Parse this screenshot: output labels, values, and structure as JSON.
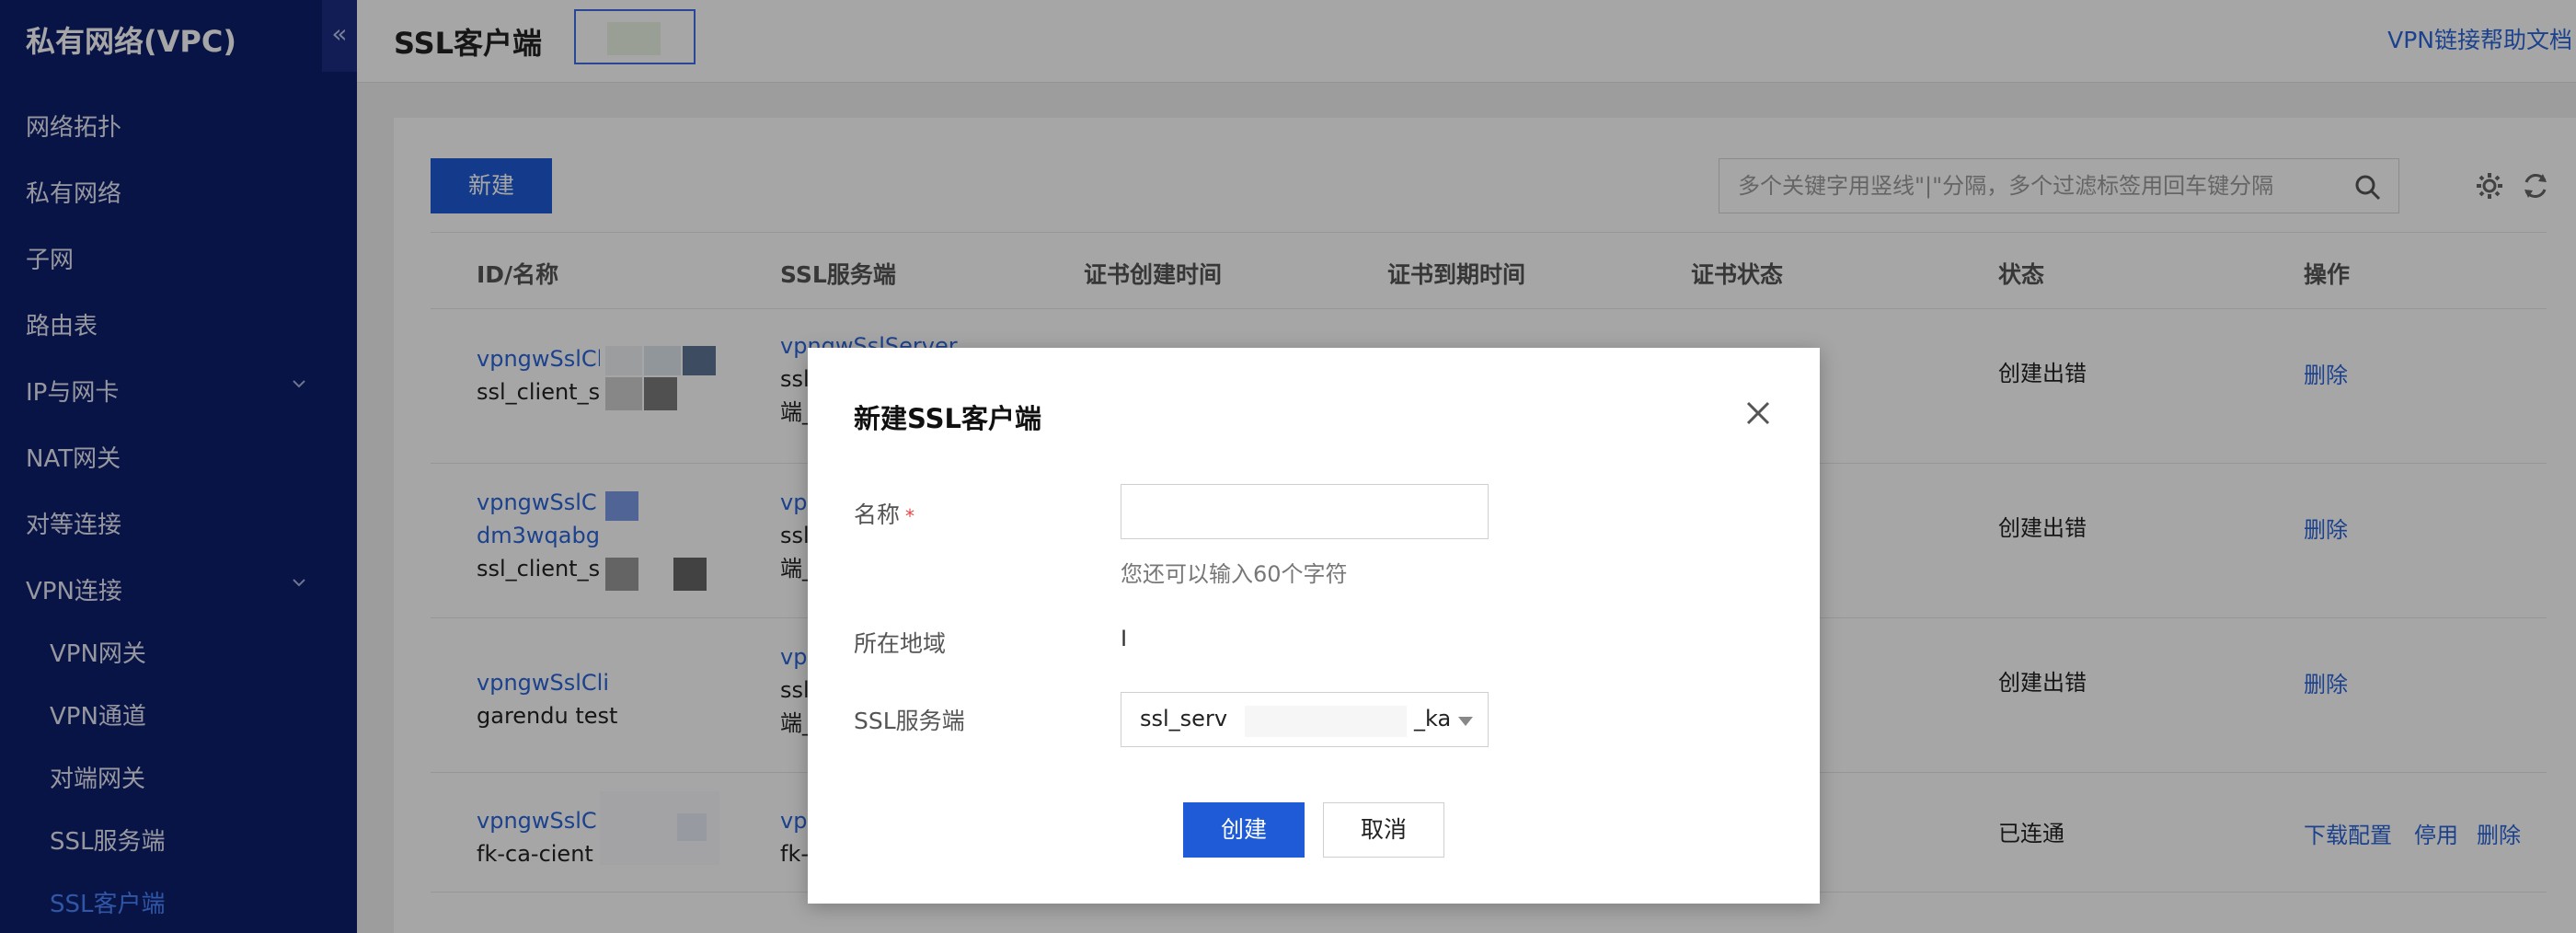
{
  "sidebar": {
    "title": "私有网络(VPC)",
    "collapse_icon": "«",
    "items": [
      {
        "label": "网络拓扑"
      },
      {
        "label": "私有网络"
      },
      {
        "label": "子网"
      },
      {
        "label": "路由表"
      },
      {
        "label": "IP与网卡"
      },
      {
        "label": "NAT网关"
      },
      {
        "label": "对等连接"
      },
      {
        "label": "VPN连接"
      },
      {
        "label": "VPN网关"
      },
      {
        "label": "VPN通道"
      },
      {
        "label": "对端网关"
      },
      {
        "label": "SSL服务端"
      },
      {
        "label": "SSL客户端"
      }
    ]
  },
  "header": {
    "title": "SSL客户端",
    "help_link": "VPN链接帮助文档"
  },
  "toolbar": {
    "new_label": "新建",
    "search_placeholder": "多个关键字用竖线\"|\"分隔，多个过滤标签用回车键分隔"
  },
  "table": {
    "columns": [
      "ID/名称",
      "SSL服务端",
      "证书创建时间",
      "证书到期时间",
      "证书状态",
      "状态",
      "操作"
    ],
    "rows": [
      {
        "id": "vpngwSslCli",
        "name": "ssl_client_ss",
        "server_line1": "vpngwSslServer",
        "server_line2": "ssl_se",
        "server_line3": "端_ka",
        "status": "创建出错",
        "action1": "删除"
      },
      {
        "id": "vpngwSslC",
        "id2": "dm3wqabg",
        "name": "ssl_client_s",
        "server_line1": "vpngw",
        "server_line2": "ssl_se",
        "server_line3": "端_ka",
        "status": "创建出错",
        "action1": "删除"
      },
      {
        "id": "vpngwSslCli",
        "name": "garendu test",
        "server_line1": "vpngw",
        "server_line2": "ssl_se",
        "server_line3": "端_ka",
        "status": "创建出错",
        "action1": "删除"
      },
      {
        "id": "vpngwSslC",
        "name": "fk-ca-cient",
        "server_line1": "vpngw",
        "server_line2": "fk-ca-",
        "status": "已连通",
        "action_download": "下载配置",
        "action_disable": "停用",
        "action1": "删除"
      }
    ]
  },
  "dialog": {
    "title": "新建SSL客户端",
    "name_label": "名称",
    "required_mark": "*",
    "name_value": "",
    "name_hint": "您还可以输入60个字符",
    "region_label": "所在地域",
    "region_value": "I",
    "server_label": "SSL服务端",
    "server_value_start": "ssl_serv",
    "server_value_end": "_ka",
    "create_label": "创建",
    "cancel_label": "取消"
  }
}
